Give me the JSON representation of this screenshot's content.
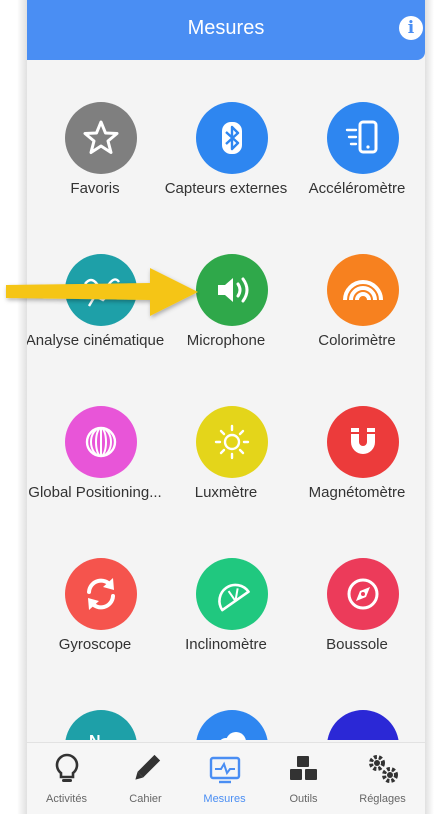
{
  "header": {
    "title": "Mesures",
    "info_icon": "i"
  },
  "tiles": [
    {
      "label": "Favoris",
      "icon": "star-icon",
      "color": "#7f7f7f"
    },
    {
      "label": "Capteurs externes",
      "icon": "bluetooth-icon",
      "color": "#2e86f0"
    },
    {
      "label": "Accéléromètre",
      "icon": "phone-motion-icon",
      "color": "#2e86f0"
    },
    {
      "label": "Analyse cinématique",
      "icon": "motion-analysis-icon",
      "color": "#1ea0a8"
    },
    {
      "label": "Microphone",
      "icon": "speaker-icon",
      "color": "#2fa84a"
    },
    {
      "label": "Colorimètre",
      "icon": "rainbow-icon",
      "color": "#f7811f"
    },
    {
      "label": "Global Positioning...",
      "icon": "globe-icon",
      "color": "#e855d8"
    },
    {
      "label": "Luxmètre",
      "icon": "sun-icon",
      "color": "#e4d51a"
    },
    {
      "label": "Magnétomètre",
      "icon": "magnet-icon",
      "color": "#ec3b3b"
    },
    {
      "label": "Gyroscope",
      "icon": "rotate-icon",
      "color": "#f5544d"
    },
    {
      "label": "Inclinomètre",
      "icon": "protractor-icon",
      "color": "#20c87f"
    },
    {
      "label": "Boussole",
      "icon": "compass-icon",
      "color": "#ec3b5a"
    }
  ],
  "partial_tiles": [
    {
      "icon": "north-icon",
      "color": "#1ea0a8",
      "letter": "N"
    },
    {
      "icon": "cloud-icon",
      "color": "#2e86f0"
    },
    {
      "icon": "footprint-icon",
      "color": "#2b28d6"
    }
  ],
  "bottom_nav": [
    {
      "label": "Activités",
      "icon": "lightbulb-icon",
      "active": false
    },
    {
      "label": "Cahier",
      "icon": "pencil-icon",
      "active": false
    },
    {
      "label": "Mesures",
      "icon": "monitor-icon",
      "active": true
    },
    {
      "label": "Outils",
      "icon": "cubes-icon",
      "active": false
    },
    {
      "label": "Réglages",
      "icon": "gears-icon",
      "active": false
    }
  ],
  "colors": {
    "accent": "#4a8ef3",
    "arrow": "#f5c518"
  }
}
